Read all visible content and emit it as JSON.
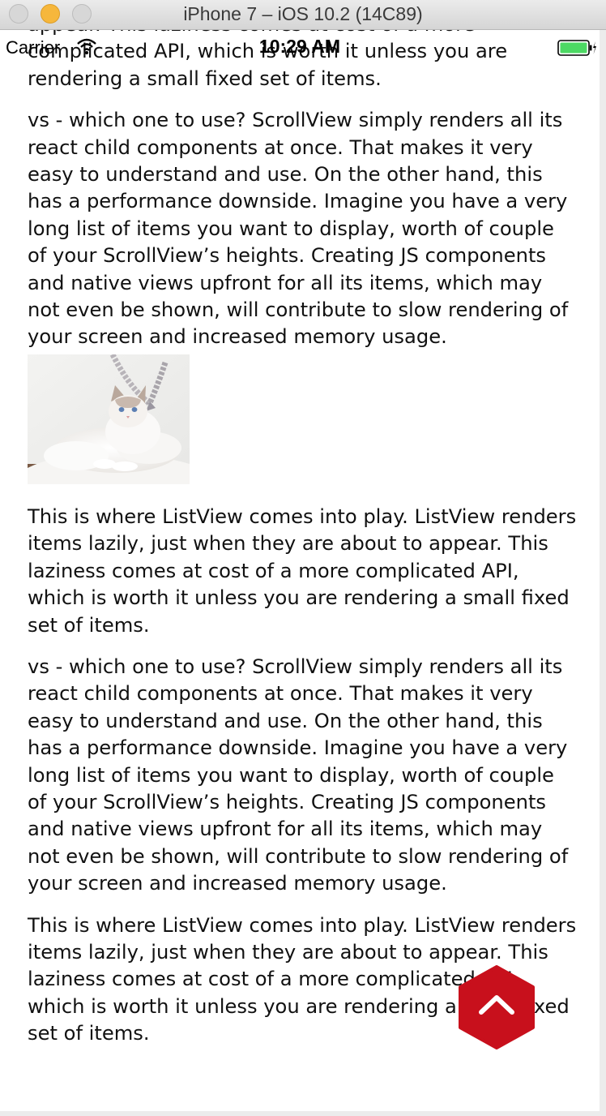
{
  "window": {
    "title": "iPhone 7 – iOS 10.2 (14C89)"
  },
  "status_bar": {
    "carrier": "Carrier",
    "time": "10:29 AM",
    "icons": [
      "wifi-icon",
      "battery-icon",
      "charging-bolt-icon"
    ],
    "battery_color": "#4cd964"
  },
  "content": {
    "paragraphs": [
      "appear. This laziness comes at cost of a more complicated API, which is worth it unless you are rendering a small fixed set of items.",
      "vs - which one to use? ScrollView simply renders all its react child components at once. That makes it very easy to understand and use. On the other hand, this has a performance downside. Imagine you have a very long list of items you want to display, worth of couple of your ScrollView’s heights. Creating JS components and native views upfront for all its items, which may not even be shown, will contribute to slow rendering of your screen and increased memory usage.",
      "This is where ListView comes into play. ListView renders items lazily, just when they are about to appear. This laziness comes at cost of a more complicated API, which is worth it unless you are rendering a small fixed set of items.",
      "vs - which one to use? ScrollView simply renders all its react child components at once. That makes it very easy to understand and use. On the other hand, this has a performance downside. Imagine you have a very long list of items you want to display, worth of couple of your ScrollView’s heights. Creating JS components and native views upfront for all its items, which may not even be shown, will contribute to slow rendering of your screen and increased memory usage.",
      "This is where ListView comes into play. ListView renders items lazily, just when they are about to appear. This laziness comes at cost of a more complicated API, which is worth it unless you are rendering a small fixed set of items."
    ],
    "image_icon": "cat-photo-icon"
  },
  "fab": {
    "icon": "chevron-up-icon",
    "color": "#c8101c"
  }
}
